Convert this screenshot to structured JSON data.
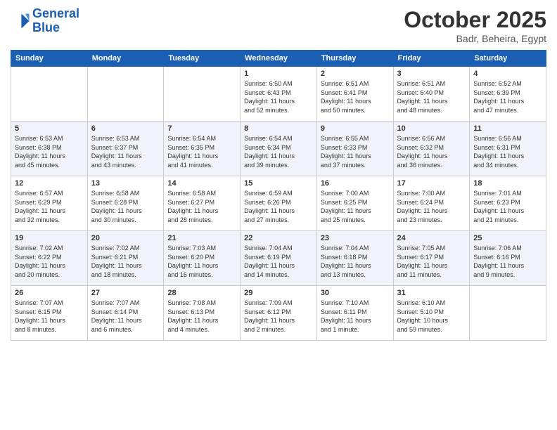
{
  "header": {
    "logo_line1": "General",
    "logo_line2": "Blue",
    "month": "October 2025",
    "location": "Badr, Beheira, Egypt"
  },
  "days_of_week": [
    "Sunday",
    "Monday",
    "Tuesday",
    "Wednesday",
    "Thursday",
    "Friday",
    "Saturday"
  ],
  "weeks": [
    [
      {
        "day": "",
        "info": ""
      },
      {
        "day": "",
        "info": ""
      },
      {
        "day": "",
        "info": ""
      },
      {
        "day": "1",
        "info": "Sunrise: 6:50 AM\nSunset: 6:43 PM\nDaylight: 11 hours\nand 52 minutes."
      },
      {
        "day": "2",
        "info": "Sunrise: 6:51 AM\nSunset: 6:41 PM\nDaylight: 11 hours\nand 50 minutes."
      },
      {
        "day": "3",
        "info": "Sunrise: 6:51 AM\nSunset: 6:40 PM\nDaylight: 11 hours\nand 48 minutes."
      },
      {
        "day": "4",
        "info": "Sunrise: 6:52 AM\nSunset: 6:39 PM\nDaylight: 11 hours\nand 47 minutes."
      }
    ],
    [
      {
        "day": "5",
        "info": "Sunrise: 6:53 AM\nSunset: 6:38 PM\nDaylight: 11 hours\nand 45 minutes."
      },
      {
        "day": "6",
        "info": "Sunrise: 6:53 AM\nSunset: 6:37 PM\nDaylight: 11 hours\nand 43 minutes."
      },
      {
        "day": "7",
        "info": "Sunrise: 6:54 AM\nSunset: 6:35 PM\nDaylight: 11 hours\nand 41 minutes."
      },
      {
        "day": "8",
        "info": "Sunrise: 6:54 AM\nSunset: 6:34 PM\nDaylight: 11 hours\nand 39 minutes."
      },
      {
        "day": "9",
        "info": "Sunrise: 6:55 AM\nSunset: 6:33 PM\nDaylight: 11 hours\nand 37 minutes."
      },
      {
        "day": "10",
        "info": "Sunrise: 6:56 AM\nSunset: 6:32 PM\nDaylight: 11 hours\nand 36 minutes."
      },
      {
        "day": "11",
        "info": "Sunrise: 6:56 AM\nSunset: 6:31 PM\nDaylight: 11 hours\nand 34 minutes."
      }
    ],
    [
      {
        "day": "12",
        "info": "Sunrise: 6:57 AM\nSunset: 6:29 PM\nDaylight: 11 hours\nand 32 minutes."
      },
      {
        "day": "13",
        "info": "Sunrise: 6:58 AM\nSunset: 6:28 PM\nDaylight: 11 hours\nand 30 minutes."
      },
      {
        "day": "14",
        "info": "Sunrise: 6:58 AM\nSunset: 6:27 PM\nDaylight: 11 hours\nand 28 minutes."
      },
      {
        "day": "15",
        "info": "Sunrise: 6:59 AM\nSunset: 6:26 PM\nDaylight: 11 hours\nand 27 minutes."
      },
      {
        "day": "16",
        "info": "Sunrise: 7:00 AM\nSunset: 6:25 PM\nDaylight: 11 hours\nand 25 minutes."
      },
      {
        "day": "17",
        "info": "Sunrise: 7:00 AM\nSunset: 6:24 PM\nDaylight: 11 hours\nand 23 minutes."
      },
      {
        "day": "18",
        "info": "Sunrise: 7:01 AM\nSunset: 6:23 PM\nDaylight: 11 hours\nand 21 minutes."
      }
    ],
    [
      {
        "day": "19",
        "info": "Sunrise: 7:02 AM\nSunset: 6:22 PM\nDaylight: 11 hours\nand 20 minutes."
      },
      {
        "day": "20",
        "info": "Sunrise: 7:02 AM\nSunset: 6:21 PM\nDaylight: 11 hours\nand 18 minutes."
      },
      {
        "day": "21",
        "info": "Sunrise: 7:03 AM\nSunset: 6:20 PM\nDaylight: 11 hours\nand 16 minutes."
      },
      {
        "day": "22",
        "info": "Sunrise: 7:04 AM\nSunset: 6:19 PM\nDaylight: 11 hours\nand 14 minutes."
      },
      {
        "day": "23",
        "info": "Sunrise: 7:04 AM\nSunset: 6:18 PM\nDaylight: 11 hours\nand 13 minutes."
      },
      {
        "day": "24",
        "info": "Sunrise: 7:05 AM\nSunset: 6:17 PM\nDaylight: 11 hours\nand 11 minutes."
      },
      {
        "day": "25",
        "info": "Sunrise: 7:06 AM\nSunset: 6:16 PM\nDaylight: 11 hours\nand 9 minutes."
      }
    ],
    [
      {
        "day": "26",
        "info": "Sunrise: 7:07 AM\nSunset: 6:15 PM\nDaylight: 11 hours\nand 8 minutes."
      },
      {
        "day": "27",
        "info": "Sunrise: 7:07 AM\nSunset: 6:14 PM\nDaylight: 11 hours\nand 6 minutes."
      },
      {
        "day": "28",
        "info": "Sunrise: 7:08 AM\nSunset: 6:13 PM\nDaylight: 11 hours\nand 4 minutes."
      },
      {
        "day": "29",
        "info": "Sunrise: 7:09 AM\nSunset: 6:12 PM\nDaylight: 11 hours\nand 2 minutes."
      },
      {
        "day": "30",
        "info": "Sunrise: 7:10 AM\nSunset: 6:11 PM\nDaylight: 11 hours\nand 1 minute."
      },
      {
        "day": "31",
        "info": "Sunrise: 6:10 AM\nSunset: 5:10 PM\nDaylight: 10 hours\nand 59 minutes."
      },
      {
        "day": "",
        "info": ""
      }
    ]
  ]
}
